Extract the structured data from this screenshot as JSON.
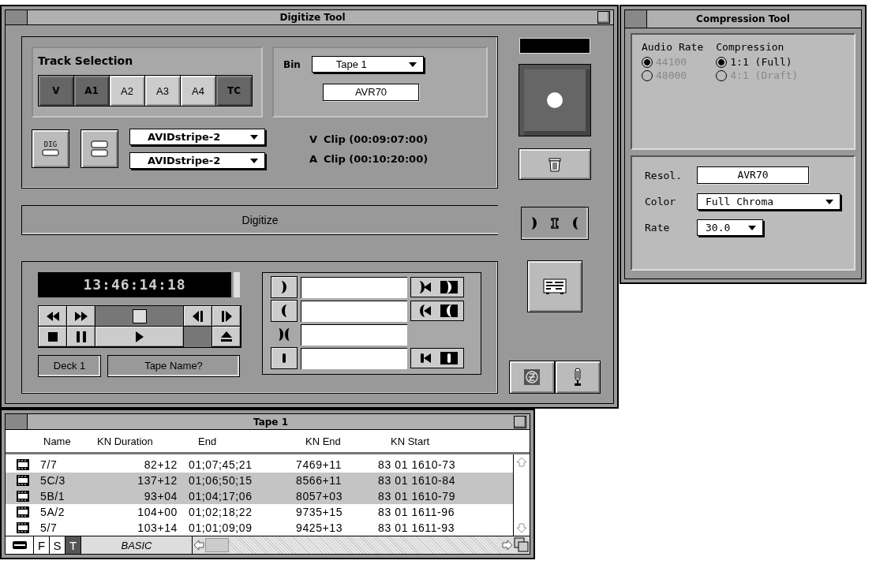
{
  "digitize_tool": {
    "title": "Digitize Tool",
    "track_selection": {
      "label": "Track Selection",
      "tracks": [
        {
          "label": "V",
          "selected": true
        },
        {
          "label": "A1",
          "selected": true
        },
        {
          "label": "A2",
          "selected": false
        },
        {
          "label": "A3",
          "selected": false
        },
        {
          "label": "A4",
          "selected": false
        },
        {
          "label": "TC",
          "selected": true
        }
      ]
    },
    "bin": {
      "label": "Bin",
      "value": "Tape 1",
      "resolution": "AVR70"
    },
    "dig_button": "DIG",
    "targets": [
      "AVIDstripe-2",
      "AVIDstripe-2"
    ],
    "clips": [
      {
        "track": "V",
        "text": "Clip (00:09:07:00)"
      },
      {
        "track": "A",
        "text": "Clip (00:10:20:00)"
      }
    ],
    "status": "Digitize",
    "timecode": "13:46:14:18",
    "shuttle": {
      "level": 0.5
    },
    "deck": "Deck 1",
    "tape_name": "Tape Name?",
    "marks": [
      {
        "kind": "in",
        "go": true
      },
      {
        "kind": "out",
        "go": true
      },
      {
        "kind": "both",
        "go": false
      },
      {
        "kind": "loc",
        "go": true
      }
    ]
  },
  "compression_tool": {
    "title": "Compression Tool",
    "audio_rate": {
      "label": "Audio Rate",
      "options": [
        {
          "label": "44100",
          "selected": true,
          "disabled": true
        },
        {
          "label": "48000",
          "selected": false,
          "disabled": true
        }
      ]
    },
    "compression": {
      "label": "Compression",
      "options": [
        {
          "label": "1:1 (Full)",
          "selected": true,
          "disabled": false
        },
        {
          "label": "4:1 (Draft)",
          "selected": false,
          "disabled": true
        }
      ]
    },
    "resolution": {
      "label": "Resol.",
      "value": "AVR70"
    },
    "color": {
      "label": "Color",
      "value": "Full Chroma"
    },
    "rate": {
      "label": "Rate",
      "value": "30.0"
    }
  },
  "bin_window": {
    "title": "Tape 1",
    "columns": [
      "Name",
      "KN Duration",
      "End",
      "KN End",
      "KN Start"
    ],
    "rows": [
      {
        "name": "7/7",
        "kn_duration": "82+12",
        "end": "01;07;45;21",
        "kn_end": "7469+11",
        "kn_start": "83 01 1610-73",
        "selected": false
      },
      {
        "name": "5C/3",
        "kn_duration": "137+12",
        "end": "01;06;50;15",
        "kn_end": "8566+11",
        "kn_start": "83 01 1610-84",
        "selected": true
      },
      {
        "name": "5B/1",
        "kn_duration": "93+04",
        "end": "01;04;17;06",
        "kn_end": "8057+03",
        "kn_start": "83 01 1610-79",
        "selected": true
      },
      {
        "name": "5A/2",
        "kn_duration": "104+00",
        "end": "01;02;18;22",
        "kn_end": "9735+15",
        "kn_start": "83 01 1611-96",
        "selected": false
      },
      {
        "name": "5/7",
        "kn_duration": "103+14",
        "end": "01;01;09;09",
        "kn_end": "9425+13",
        "kn_start": "83 01 1611-93",
        "selected": false
      }
    ],
    "footer": {
      "views": [
        {
          "label": "F",
          "selected": false
        },
        {
          "label": "S",
          "selected": false
        },
        {
          "label": "T",
          "selected": true
        }
      ],
      "view_name": "BASIC"
    }
  }
}
